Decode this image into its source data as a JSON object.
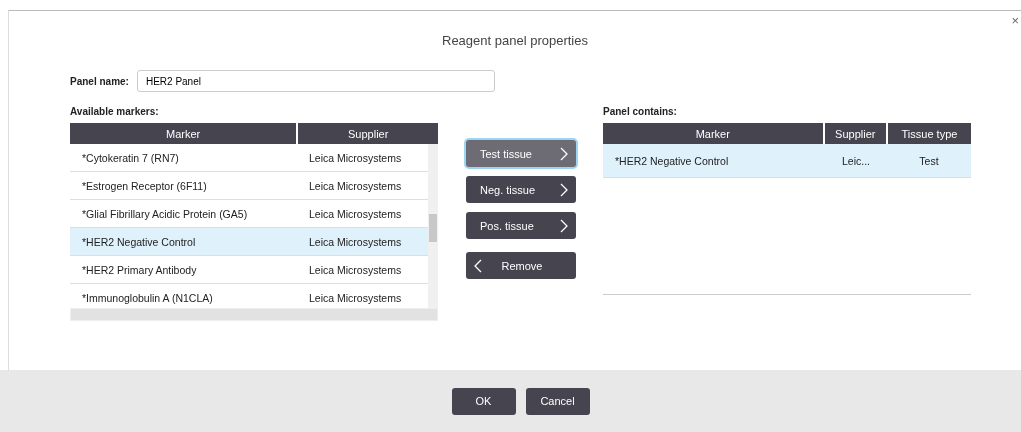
{
  "window": {
    "title": "Reagent panel properties",
    "close": "×"
  },
  "panel_name": {
    "label": "Panel name:",
    "value": "HER2 Panel"
  },
  "available": {
    "label": "Available markers:",
    "columns": [
      "Marker",
      "Supplier"
    ],
    "rows": [
      {
        "marker": "*Cytokeratin 7 (RN7)",
        "supplier": "Leica Microsystems",
        "selected": false
      },
      {
        "marker": "*Estrogen Receptor (6F11)",
        "supplier": "Leica Microsystems",
        "selected": false
      },
      {
        "marker": "*Glial Fibrillary Acidic Protein (GA5)",
        "supplier": "Leica Microsystems",
        "selected": false
      },
      {
        "marker": "*HER2 Negative Control",
        "supplier": "Leica Microsystems",
        "selected": true
      },
      {
        "marker": "*HER2 Primary Antibody",
        "supplier": "Leica Microsystems",
        "selected": false
      },
      {
        "marker": "*Immunoglobulin A (N1CLA)",
        "supplier": "Leica Microsystems",
        "selected": false
      }
    ]
  },
  "actions": [
    {
      "label": "Test tissue",
      "kind": "add",
      "focused": true
    },
    {
      "label": "Neg. tissue",
      "kind": "add",
      "focused": false
    },
    {
      "label": "Pos. tissue",
      "kind": "add",
      "focused": false
    },
    {
      "label": "Remove",
      "kind": "remove",
      "focused": false
    }
  ],
  "contains": {
    "label": "Panel contains:",
    "columns": [
      "Marker",
      "Supplier",
      "Tissue type"
    ],
    "rows": [
      {
        "marker": "*HER2 Negative Control",
        "supplier": "Leic...",
        "tissue_type": "Test",
        "selected": true
      }
    ]
  },
  "buttons": [
    "OK",
    "Cancel"
  ]
}
